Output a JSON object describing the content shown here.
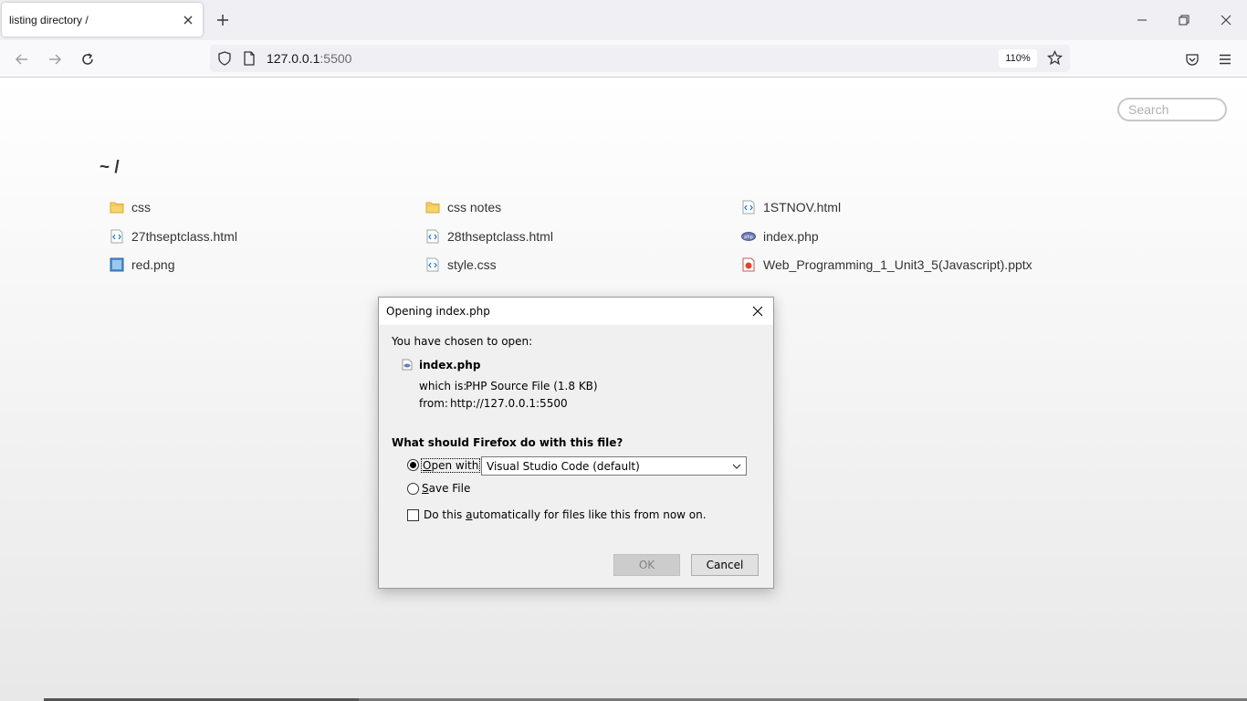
{
  "browser": {
    "tab_title": "listing directory /",
    "url_host": "127.0.0.1",
    "url_port": ":5500",
    "zoom": "110%"
  },
  "page": {
    "search_placeholder": "Search",
    "heading": "~ /",
    "files": [
      {
        "name": "css",
        "icon": "folder-icon"
      },
      {
        "name": "css notes",
        "icon": "folder-icon"
      },
      {
        "name": "1STNOV.html",
        "icon": "code-file-icon"
      },
      {
        "name": "27thseptclass.html",
        "icon": "code-file-icon"
      },
      {
        "name": "28thseptclass.html",
        "icon": "code-file-icon"
      },
      {
        "name": "index.php",
        "icon": "php-file-icon"
      },
      {
        "name": "red.png",
        "icon": "image-file-icon"
      },
      {
        "name": "style.css",
        "icon": "code-file-icon"
      },
      {
        "name": "Web_Programming_1_Unit3_5(Javascript).pptx",
        "icon": "pptx-file-icon"
      }
    ]
  },
  "dialog": {
    "title": "Opening index.php",
    "chosen_label": "You have chosen to open:",
    "file_name": "index.php",
    "which_is_label": "which is:",
    "which_is_value": "PHP Source File (1.8 KB)",
    "from_label": "from:",
    "from_value": "http://127.0.0.1:5500",
    "question": "What should Firefox do with this file?",
    "open_with_prefix": "",
    "open_with_u": "O",
    "open_with_rest": "pen with",
    "open_with_app": "Visual Studio Code (default)",
    "save_u": "S",
    "save_rest": "ave File",
    "auto_pre": "Do this ",
    "auto_u": "a",
    "auto_rest": "utomatically for files like this from now on.",
    "ok_label": "OK",
    "cancel_label": "Cancel"
  }
}
